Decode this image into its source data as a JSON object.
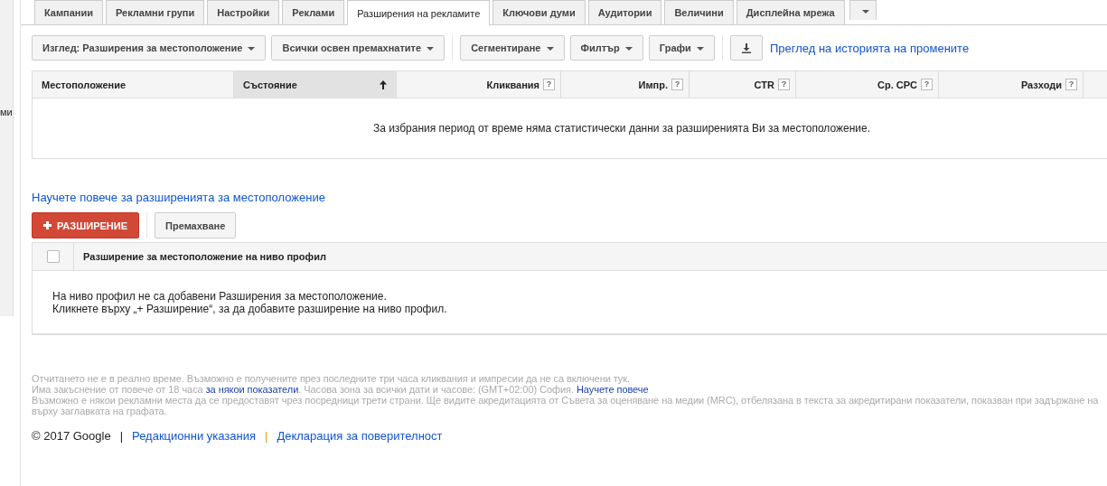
{
  "sidebar": {
    "text": "ми"
  },
  "tabs": [
    {
      "label": "Кампании",
      "selected": false
    },
    {
      "label": "Рекламни групи",
      "selected": false
    },
    {
      "label": "Настройки",
      "selected": false
    },
    {
      "label": "Реклами",
      "selected": false
    },
    {
      "label": "Разширения на рекламите",
      "selected": true
    },
    {
      "label": "Ключови думи",
      "selected": false
    },
    {
      "label": "Аудитории",
      "selected": false
    },
    {
      "label": "Величини",
      "selected": false
    },
    {
      "label": "Дисплейна мрежа",
      "selected": false
    }
  ],
  "toolbar": {
    "dropdowns": [
      "Изглед: Разширения за местоположение",
      "Всички освен премахнатите"
    ],
    "dropdowns_2": [
      "Сегментиране",
      "Филтър",
      "Графи"
    ],
    "history_link": "Преглед на историята на промените"
  },
  "table": {
    "columns": [
      {
        "label": "Местоположение",
        "sorted": false
      },
      {
        "label": "Състояние",
        "sorted": true
      },
      {
        "label": "Кликвания",
        "help": "?",
        "sorted": false
      },
      {
        "label": "Импр.",
        "help": "?",
        "sorted": false
      },
      {
        "label": "CTR",
        "help": "?",
        "sorted": false
      },
      {
        "label": "Ср. CPC",
        "help": "?",
        "sorted": false
      },
      {
        "label": "Разходи",
        "help": "?",
        "sorted": false
      }
    ],
    "empty_message": "За избрания период от време няма статистически данни за разширенията Ви за местоположение."
  },
  "learn_more_link": "Научете повече за разширенията за местоположение",
  "actions": {
    "add_button": "РАЗШИРЕНИЕ",
    "remove_button": "Премахване"
  },
  "account_table": {
    "checked": false,
    "column": "Разширение за местоположение на ниво профил",
    "empty_lines": [
      "На ниво профил не са добавени Разширения за местоположение.",
      "Кликнете върху „+ Разширение“, за да добавите разширение на ниво профил."
    ]
  },
  "notes": {
    "line_1": "Отчитането не е в реално време. Възможно е получените през последните три часа кликвания и импресии да не са включени тук.",
    "line_2_start": "Има закъснение от повече от 18 часа",
    "line_2_link": "за някои показатели",
    "line_2_middle": ". Часова зона за всички дати и часове: (GMT+02:00) София.",
    "line_2_link_2": "Научете повече",
    "line_3": "Възможно е някои рекламни места да се предоставят чрез посредници трети страни. Ще видите акредитацията от Съвета за оценяване на медии (MRC), отбелязана в текста за акредитирани показатели, показван при задържане на",
    "line_4": "върху заглавката на графата."
  },
  "footer": {
    "copyright": "© 2017 Google",
    "separator": "|",
    "links": [
      "Редакционни указания",
      "Декларация за поверителност"
    ]
  }
}
